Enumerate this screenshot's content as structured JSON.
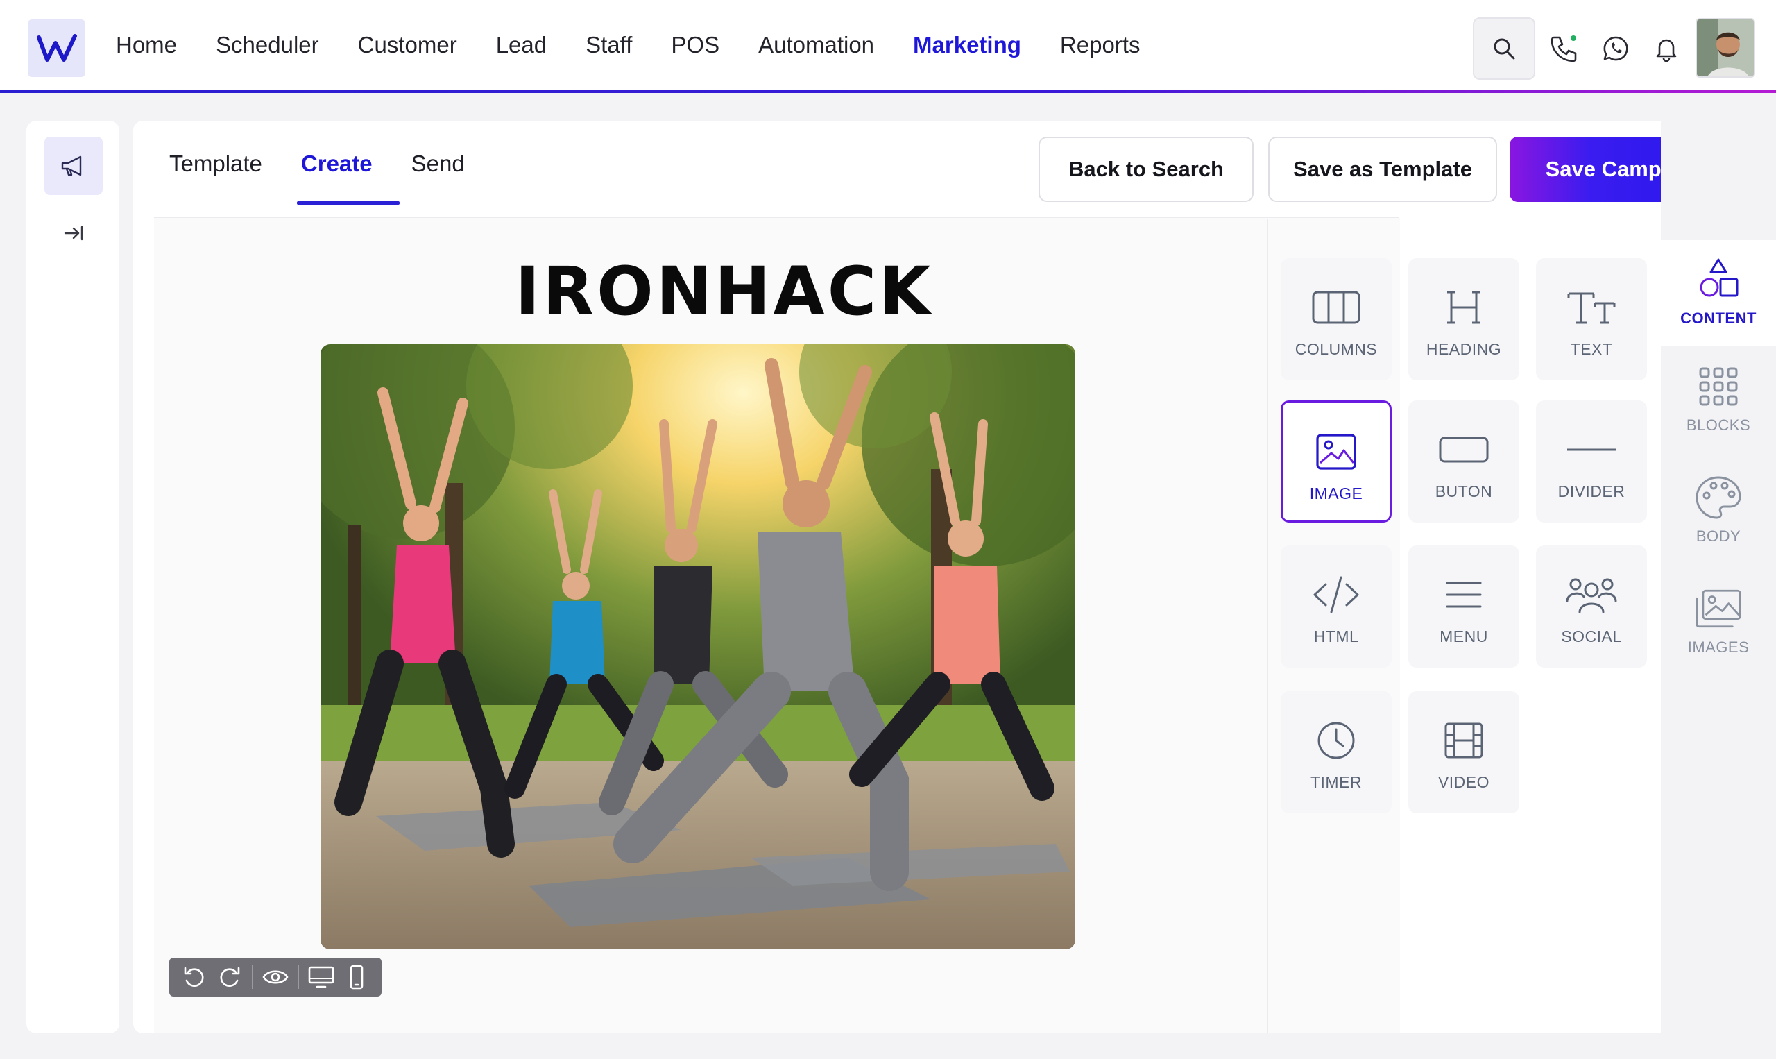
{
  "nav": {
    "items": [
      "Home",
      "Scheduler",
      "Customer",
      "Lead",
      "Staff",
      "POS",
      "Automation",
      "Marketing",
      "Reports"
    ],
    "active": "Marketing"
  },
  "tabs": {
    "template": "Template",
    "create": "Create",
    "send": "Send"
  },
  "actions": {
    "back": "Back to Search",
    "save_template": "Save as Template",
    "save_campaign": "Save Campaign"
  },
  "canvas": {
    "brand": "IRONHACK"
  },
  "tools": [
    {
      "label": "COLUMNS",
      "icon": "columns-icon"
    },
    {
      "label": "HEADING",
      "icon": "heading-icon"
    },
    {
      "label": "TEXT",
      "icon": "text-icon"
    },
    {
      "label": "IMAGE",
      "icon": "image-icon",
      "selected": true
    },
    {
      "label": "BUTON",
      "icon": "button-icon"
    },
    {
      "label": "DIVIDER",
      "icon": "divider-icon"
    },
    {
      "label": "HTML",
      "icon": "code-icon"
    },
    {
      "label": "MENU",
      "icon": "menu-icon"
    },
    {
      "label": "SOCIAL",
      "icon": "social-icon"
    },
    {
      "label": "TIMER",
      "icon": "clock-icon"
    },
    {
      "label": "VIDEO",
      "icon": "film-icon"
    }
  ],
  "side_tabs": [
    {
      "label": "CONTENT",
      "icon": "shapes-icon",
      "active": true
    },
    {
      "label": "BLOCKS",
      "icon": "grid-icon"
    },
    {
      "label": "BODY",
      "icon": "palette-icon"
    },
    {
      "label": "IMAGES",
      "icon": "images-icon"
    }
  ],
  "colors": {
    "accent": "#1f17d8",
    "selected_border": "#6a1be0",
    "primary_gradient_start": "#8a16e0",
    "primary_gradient_end": "#2417ea"
  }
}
